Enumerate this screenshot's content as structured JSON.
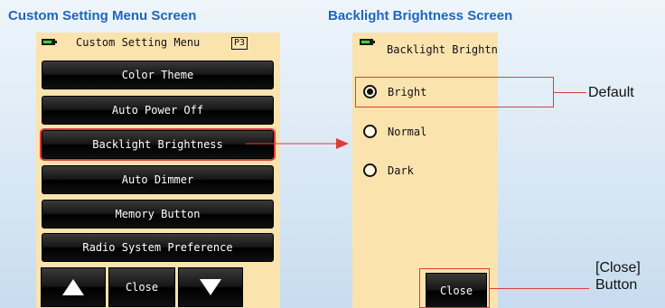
{
  "captions": {
    "left": "Custom Setting Menu Screen",
    "right": "Backlight Brightness Screen"
  },
  "menu_screen": {
    "title": "Custom Setting Menu",
    "page_badge": "P3",
    "items": [
      {
        "label": "Color Theme",
        "selected": false
      },
      {
        "label": "Auto Power Off",
        "selected": false
      },
      {
        "label": "Backlight Brightness",
        "selected": true
      },
      {
        "label": "Auto Dimmer",
        "selected": false
      },
      {
        "label": "Memory Button",
        "selected": false
      },
      {
        "label": "Radio System Preference",
        "selected": false
      }
    ],
    "nav": {
      "up_icon": "up-arrow-icon",
      "close_label": "Close",
      "down_icon": "down-arrow-icon"
    }
  },
  "brightness_screen": {
    "title": "Backlight Brightness",
    "options": [
      {
        "label": "Bright",
        "checked": true
      },
      {
        "label": "Normal",
        "checked": false
      },
      {
        "label": "Dark",
        "checked": false
      }
    ],
    "close_label": "Close"
  },
  "annotations": {
    "default_label": "Default",
    "close_button_line1": "[Close]",
    "close_button_line2": "Button"
  },
  "colors": {
    "caption": "#1f66b8",
    "screen_bg": "#fbe3ae",
    "highlight": "#e03b3b",
    "battery": "#42d23c"
  }
}
